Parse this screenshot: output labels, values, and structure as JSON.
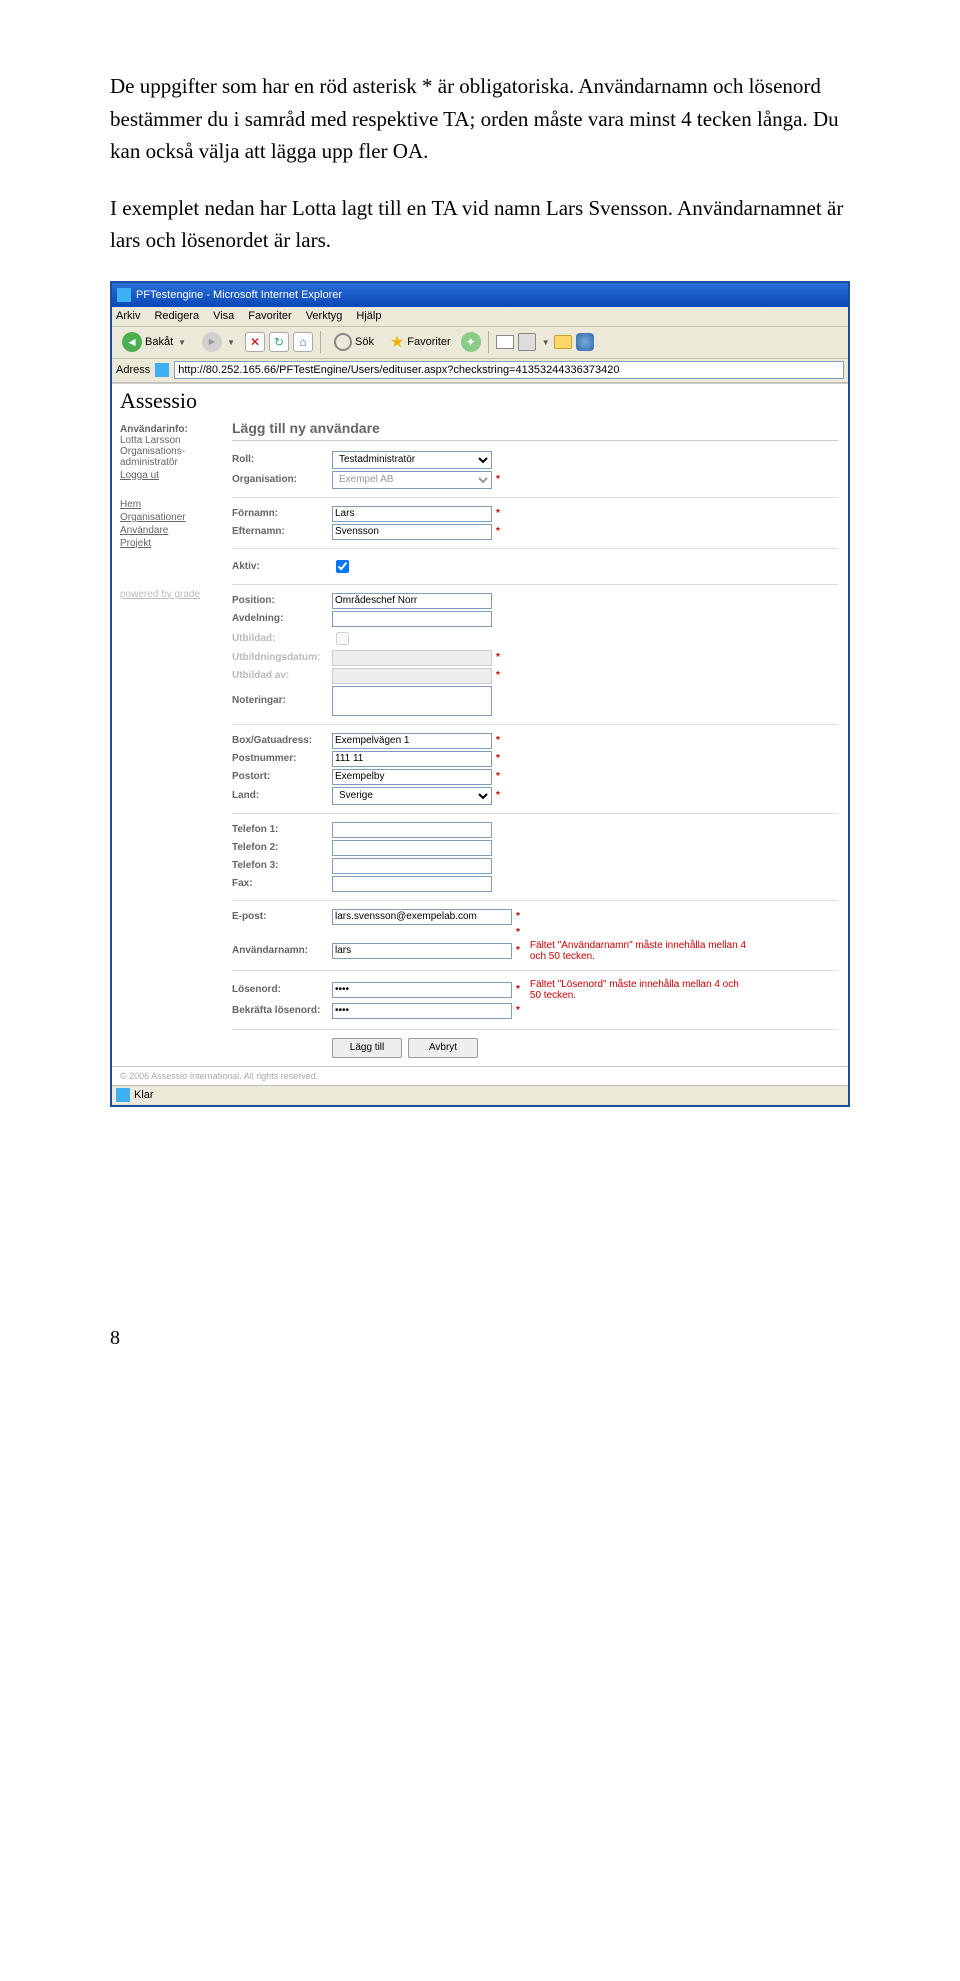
{
  "doc": {
    "p1": "De uppgifter som har en röd asterisk * är obligatoriska. Användarnamn och lösenord bestämmer du i samråd med respektive TA; orden måste vara minst 4 tecken långa. Du kan också välja att lägga upp fler OA.",
    "p2": "I exemplet nedan har Lotta lagt till en TA vid namn Lars Svensson. Användarnamnet är lars och lösenordet är lars.",
    "page_number": "8"
  },
  "ie": {
    "title": "PFTestengine - Microsoft Internet Explorer",
    "menu": [
      "Arkiv",
      "Redigera",
      "Visa",
      "Favoriter",
      "Verktyg",
      "Hjälp"
    ],
    "toolbar": {
      "back": "Bakåt",
      "search": "Sök",
      "favorites": "Favoriter"
    },
    "addr_label": "Adress",
    "addr_value": "http://80.252.165.66/PFTestEngine/Users/edituser.aspx?checkstring=41353244336373420",
    "status": "Klar"
  },
  "app": {
    "brand": "Assessio",
    "sidebar": {
      "userinfo_label": "Användarinfo:",
      "user": "Lotta Larsson",
      "role": "Organisations-administratör",
      "logout": "Logga ut",
      "nav": [
        "Hem",
        "Organisationer",
        "Användare",
        "Projekt"
      ],
      "powered": "powered by grade"
    },
    "main": {
      "title": "Lägg till ny användare",
      "labels": {
        "roll": "Roll:",
        "org": "Organisation:",
        "fornamn": "Förnamn:",
        "efternamn": "Efternamn:",
        "aktiv": "Aktiv:",
        "position": "Position:",
        "avdelning": "Avdelning:",
        "utbildad": "Utbildad:",
        "utbdatum": "Utbildningsdatum:",
        "utbildadav": "Utbildad av:",
        "noteringar": "Noteringar:",
        "box": "Box/Gatuadress:",
        "postnr": "Postnummer:",
        "postort": "Postort:",
        "land": "Land:",
        "tel1": "Telefon 1:",
        "tel2": "Telefon 2:",
        "tel3": "Telefon 3:",
        "fax": "Fax:",
        "epost": "E-post:",
        "user": "Användarnamn:",
        "pass": "Lösenord:",
        "pass2": "Bekräfta lösenord:"
      },
      "values": {
        "roll": "Testadministratör",
        "org": "Exempel AB",
        "fornamn": "Lars",
        "efternamn": "Svensson",
        "position": "Områdeschef Norr",
        "box": "Exempelvägen 1",
        "postnr": "111 11",
        "postort": "Exempelby",
        "land": "Sverige",
        "epost": "lars.svensson@exempelab.com",
        "user": "lars",
        "pass": "••••",
        "pass2": "••••"
      },
      "notes": {
        "user": "Fältet \"Användarnamn\" måste innehålla mellan 4 och 50 tecken.",
        "pass": "Fältet \"Lösenord\" måste innehålla mellan 4 och 50 tecken."
      },
      "buttons": {
        "add": "Lägg till",
        "cancel": "Avbryt"
      }
    },
    "footer": "© 2006 Assessio International. All rights reserved."
  }
}
